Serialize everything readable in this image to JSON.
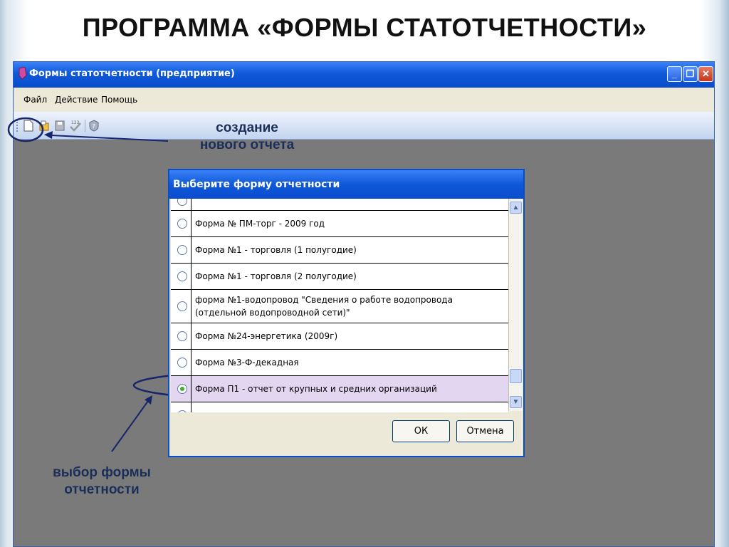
{
  "slide": {
    "title": "ПРОГРАММА «ФОРМЫ СТАТОТЧЕТНОСТИ»"
  },
  "window": {
    "title": "Формы статотчетности (предприятие)",
    "menu": [
      "Файл",
      "Действие",
      "Помощь"
    ]
  },
  "toolbar": {
    "icons": [
      "new-document-icon",
      "open-folder-icon",
      "save-disk-icon",
      "check-123-icon",
      "help-shield-icon"
    ]
  },
  "annotations": {
    "new_report_line1": "создание",
    "new_report_line2": "нового отчета",
    "select_form_line1": "выбор формы",
    "select_form_line2": "отчетности"
  },
  "dialog": {
    "title": "Выберите форму отчетности",
    "items": [
      {
        "label": "",
        "selected": false
      },
      {
        "label": "Форма № ПМ-торг - 2009 год",
        "selected": false
      },
      {
        "label": "Форма №1 - торговля (1 полугодие)",
        "selected": false
      },
      {
        "label": "Форма №1 - торговля (2 полугодие)",
        "selected": false
      },
      {
        "label": "форма №1-водопровод \"Сведения о работе водопровода (отдельной водопроводной сети)\"",
        "selected": false
      },
      {
        "label": "Форма №24-энергетика (2009г)",
        "selected": false
      },
      {
        "label": "Форма №3-Ф-декадная",
        "selected": false
      },
      {
        "label": "Форма П1 - отчет от крупных и средних организаций",
        "selected": true
      },
      {
        "label": "",
        "selected": false
      }
    ],
    "ok_label": "ОК",
    "cancel_label": "Отмена"
  },
  "colors": {
    "accent": "#0a4dcc",
    "annotation": "#1a2e5a",
    "selected_row": "#e3d6f0"
  }
}
